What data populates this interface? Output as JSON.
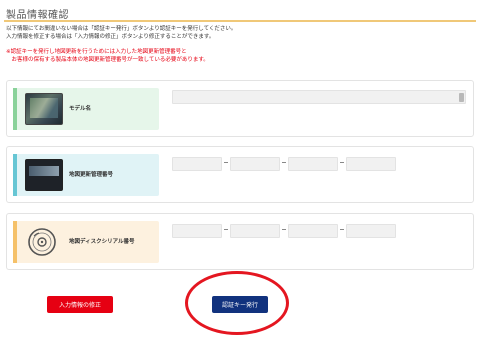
{
  "header": {
    "title": "製品情報確認"
  },
  "info_lines": [
    "以下情報にてお間違いない場合は「認証キー発行」ボタンより認証キーを発行してください。",
    "入力情報を修正する場合は「入力情報の修正」ボタンより修正することができます。"
  ],
  "notice_lines": [
    "※認証キーを発行し地図更新を行うためには入力した地図更新管理番号と",
    "　お客様の保有する製品本体の地図更新管理番号が一致している必要があります。"
  ],
  "fields": {
    "model": {
      "label": "モデル名",
      "value": ""
    },
    "map_code": {
      "label": "地図更新管理番号",
      "segments": [
        "",
        "",
        "",
        ""
      ]
    },
    "disc_serial": {
      "label": "地図ディスクシリアル番号",
      "segments": [
        "",
        "",
        "",
        ""
      ]
    }
  },
  "buttons": {
    "edit": "入力情報の修正",
    "issue": "認証キー発行"
  },
  "colors": {
    "title_rule": "#f0c878",
    "notice_red": "#e60012",
    "edit_button": "#e60012",
    "issue_button": "#11327e",
    "highlight_circle": "#e41620"
  },
  "icons": {
    "model": "navigation-unit-thumbnail",
    "map_code": "map-code-thumbnail",
    "disc": "disc-icon"
  }
}
